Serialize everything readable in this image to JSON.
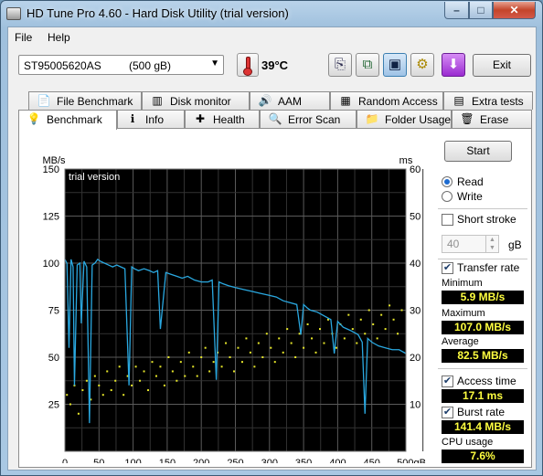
{
  "window": {
    "title": "HD Tune Pro 4.60 - Hard Disk Utility (trial version)",
    "minimize": "–",
    "maximize": "□",
    "close": "✕"
  },
  "menu": {
    "file": "File",
    "help": "Help"
  },
  "toolbar": {
    "drive_name": "ST95005620AS",
    "drive_size": "(500 gB)",
    "temperature": "39°C",
    "exit_label": "Exit"
  },
  "tabs_row1": [
    {
      "label": "File Benchmark",
      "icon": "file-benchmark-icon",
      "glyph": "📄"
    },
    {
      "label": "Disk monitor",
      "icon": "disk-monitor-icon",
      "glyph": "▥"
    },
    {
      "label": "AAM",
      "icon": "speaker-icon",
      "glyph": "🔊"
    },
    {
      "label": "Random Access",
      "icon": "random-access-icon",
      "glyph": "▦"
    },
    {
      "label": "Extra tests",
      "icon": "extra-tests-icon",
      "glyph": "▤"
    }
  ],
  "tabs_row2": [
    {
      "label": "Benchmark",
      "icon": "benchmark-icon",
      "glyph": "💡"
    },
    {
      "label": "Info",
      "icon": "info-icon",
      "glyph": "ℹ"
    },
    {
      "label": "Health",
      "icon": "health-icon",
      "glyph": "✚"
    },
    {
      "label": "Error Scan",
      "icon": "error-scan-icon",
      "glyph": "🔍"
    },
    {
      "label": "Folder Usage",
      "icon": "folder-icon",
      "glyph": "📁"
    },
    {
      "label": "Erase",
      "icon": "trash-icon",
      "glyph": "🗑"
    }
  ],
  "side": {
    "start_label": "Start",
    "read_label": "Read",
    "write_label": "Write",
    "short_stroke_label": "Short stroke",
    "short_stroke_value": "40",
    "gb_unit": "gB",
    "transfer_rate_label": "Transfer rate",
    "minimum_label": "Minimum",
    "minimum_value": "5.9 MB/s",
    "maximum_label": "Maximum",
    "maximum_value": "107.0 MB/s",
    "average_label": "Average",
    "average_value": "82.5 MB/s",
    "access_time_label": "Access time",
    "access_time_value": "17.1 ms",
    "burst_rate_label": "Burst rate",
    "burst_rate_value": "141.4 MB/s",
    "cpu_usage_label": "CPU usage",
    "cpu_usage_value": "7.6%"
  },
  "chart_data": {
    "type": "line",
    "watermark": "trial version",
    "y_left_unit": "MB/s",
    "y_right_unit": "ms",
    "x_unit": "gB",
    "xlim": [
      0,
      500
    ],
    "ylim_left": [
      0,
      150
    ],
    "ylim_right": [
      0,
      60
    ],
    "x_ticks": [
      "0",
      "50",
      "100",
      "150",
      "200",
      "250",
      "300",
      "350",
      "400",
      "450",
      "500gB"
    ],
    "y_left_ticks": [
      "150",
      "125",
      "100",
      "75",
      "50",
      "25"
    ],
    "y_right_ticks": [
      "60",
      "50",
      "40",
      "30",
      "20",
      "10"
    ],
    "grid": true,
    "colors": {
      "background": "#000000",
      "transfer_line": "#2aa8e0",
      "access_points": "#e6e62a",
      "grid": "#5a5a5a"
    },
    "series": [
      {
        "x": [
          0,
          3,
          6,
          9,
          12,
          14,
          18,
          22,
          24,
          28,
          32,
          36,
          40,
          44,
          48,
          52,
          58,
          64,
          70,
          76,
          82,
          88,
          94,
          98,
          102,
          108,
          116,
          124,
          130,
          136,
          140,
          148,
          156,
          164,
          172,
          180,
          190,
          200,
          210,
          216,
          222,
          226,
          232,
          240,
          250,
          262,
          274,
          286,
          298,
          310,
          320,
          330,
          340,
          346,
          350,
          356,
          360,
          370,
          380,
          390,
          395,
          400,
          408,
          414,
          420,
          430,
          436,
          440,
          444,
          450,
          460,
          470,
          480,
          490,
          500
        ],
        "y": [
          102,
          100,
          55,
          102,
          98,
          35,
          99,
          100,
          68,
          101,
          98,
          15,
          99,
          100,
          102,
          101,
          100,
          99,
          98,
          99,
          98,
          97,
          35,
          98,
          97,
          96,
          97,
          96,
          95,
          96,
          65,
          95,
          94,
          93,
          92,
          93,
          91,
          90,
          90,
          91,
          38,
          90,
          89,
          88,
          87,
          86,
          85,
          84,
          83,
          82,
          80,
          79,
          78,
          62,
          78,
          76,
          75,
          74,
          72,
          70,
          52,
          69,
          66,
          65,
          64,
          62,
          58,
          20,
          60,
          58,
          56,
          55,
          54,
          54,
          52
        ]
      },
      {
        "x": [
          3,
          8,
          14,
          20,
          26,
          32,
          38,
          44,
          50,
          56,
          62,
          68,
          74,
          80,
          86,
          92,
          98,
          104,
          110,
          116,
          122,
          128,
          134,
          140,
          146,
          152,
          158,
          164,
          170,
          176,
          182,
          188,
          194,
          200,
          206,
          212,
          218,
          224,
          230,
          236,
          242,
          248,
          254,
          260,
          266,
          272,
          278,
          284,
          290,
          296,
          302,
          308,
          314,
          320,
          326,
          332,
          338,
          344,
          350,
          356,
          362,
          368,
          374,
          380,
          386,
          392,
          398,
          404,
          410,
          416,
          422,
          428,
          434,
          440,
          446,
          452,
          458,
          464,
          470,
          476,
          482,
          488,
          494
        ],
        "y": [
          12,
          10,
          14,
          8,
          13,
          15,
          11,
          16,
          14,
          12,
          17,
          13,
          15,
          18,
          12,
          16,
          14,
          18,
          15,
          17,
          13,
          19,
          16,
          18,
          14,
          20,
          17,
          15,
          19,
          16,
          21,
          18,
          16,
          20,
          22,
          17,
          19,
          21,
          18,
          23,
          20,
          17,
          22,
          19,
          24,
          21,
          18,
          23,
          20,
          25,
          22,
          19,
          24,
          21,
          26,
          23,
          20,
          25,
          22,
          27,
          24,
          21,
          26,
          23,
          28,
          25,
          22,
          27,
          24,
          29,
          26,
          23,
          28,
          25,
          30,
          27,
          24,
          29,
          26,
          31,
          28,
          25,
          30
        ]
      }
    ]
  }
}
